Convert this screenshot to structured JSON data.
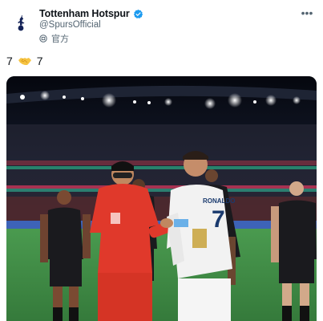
{
  "account": {
    "display_name": "Tottenham Hotspur",
    "handle": "@SpursOfficial",
    "official_label": "官方",
    "verified": true,
    "avatar_icon": "spurs-cockerel-icon"
  },
  "menu": {
    "more_label": "•••"
  },
  "tweet": {
    "text_left": "7",
    "emoji_icon": "handshake-icon",
    "text_right": "7"
  },
  "media": {
    "image_description_icon": "match-photo",
    "player_number_right": "7",
    "player_name_right": "RONALDO"
  },
  "colors": {
    "verified_blue": "#1d9bf0",
    "secondary_text": "#536471",
    "korea_red": "#e0392b",
    "portugal_white": "#f2f2f2",
    "pitch_green": "#3f8f45"
  }
}
